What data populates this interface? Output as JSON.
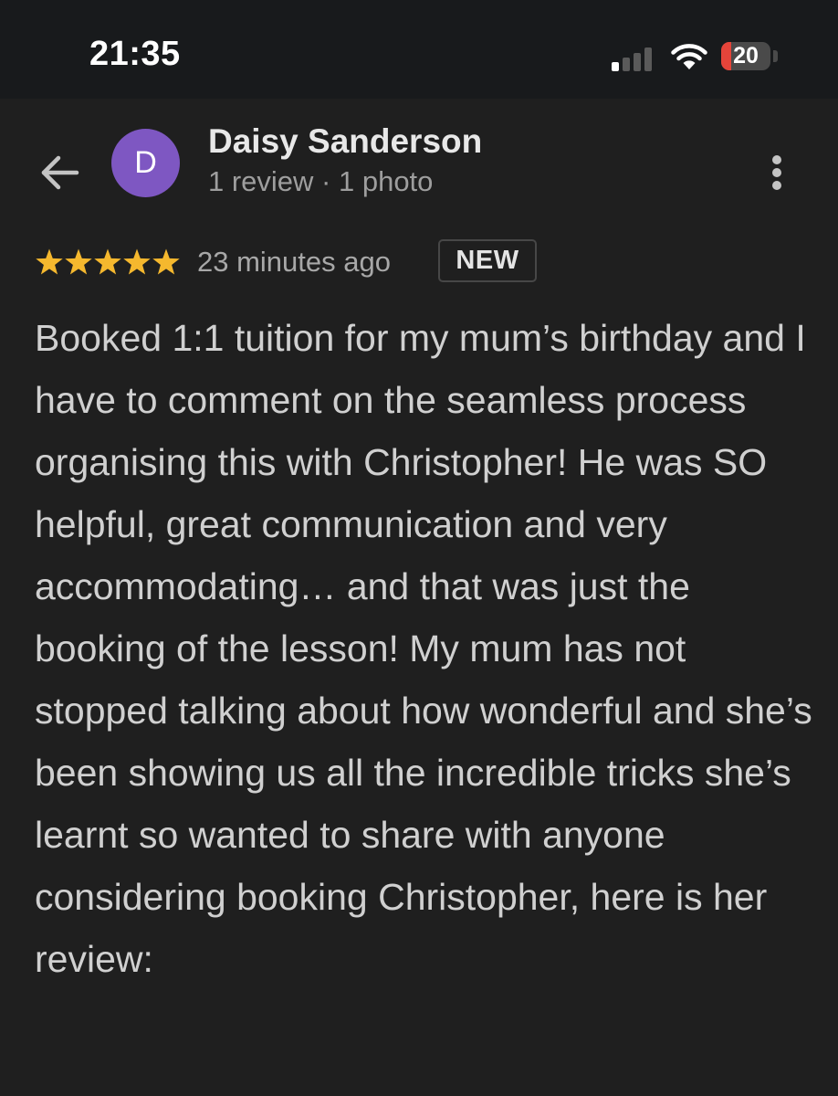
{
  "status_bar": {
    "time": "21:35",
    "battery_level": "20",
    "battery_fraction": 0.2,
    "cell_signal_bars_active": 1,
    "cell_signal_bars_total": 4
  },
  "review": {
    "author_initial": "D",
    "author_name": "Daisy Sanderson",
    "author_meta": "1 review · 1 photo",
    "rating": 5,
    "rating_max": 5,
    "time_ago": "23 minutes ago",
    "badge": "NEW",
    "text": "Booked 1:1 tuition for my mum’s birthday and I have to comment on the seamless process organising this with Christopher! He was SO helpful, great communication and very accommodating… and that was just the booking of the lesson! My mum has not stopped talking about how wonderful and she’s been showing us all the incredible tricks she’s learnt so wanted to share with anyone considering booking Christopher, here is her review:"
  },
  "icons": {
    "back": "back-arrow-icon",
    "more": "more-vert-icon",
    "star": "star-icon",
    "wifi": "wifi-icon",
    "signal": "cell-signal-icon",
    "battery": "battery-icon"
  },
  "colors": {
    "background": "#1f1f1f",
    "status_bar": "#181a1c",
    "avatar": "#7e57c2",
    "star": "#f5b82e",
    "battery_low": "#e5443a"
  }
}
